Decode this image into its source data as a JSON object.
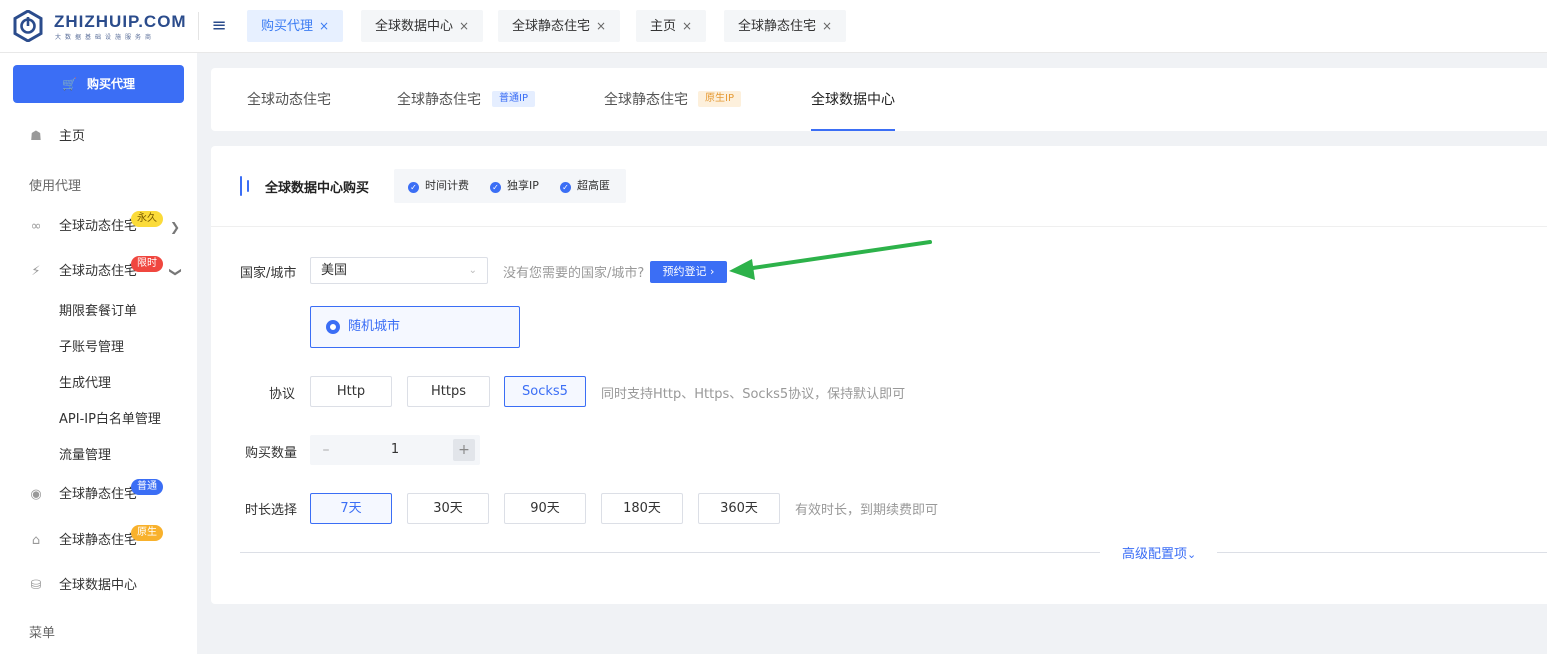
{
  "brand": {
    "name": "ZHIZHUIP.COM",
    "tagline": "大数据基础设施服务商",
    "accent_color": "#3b6ef5"
  },
  "header": {
    "menu_icon": "hamburger-icon",
    "tabs": [
      {
        "label": "购买代理",
        "active": true
      },
      {
        "label": "全球数据中心",
        "active": false
      },
      {
        "label": "全球静态住宅",
        "active": false
      },
      {
        "label": "主页",
        "active": false
      },
      {
        "label": "全球静态住宅",
        "active": false
      }
    ],
    "tab_close": "×"
  },
  "sidebar": {
    "buy_button": "购买代理",
    "home": "主页",
    "section_use": "使用代理",
    "items": [
      {
        "label": "全球动态住宅",
        "badge": "永久"
      },
      {
        "label": "全球动态住宅",
        "badge": "限时"
      },
      {
        "label": "期限套餐订单"
      },
      {
        "label": "子账号管理"
      },
      {
        "label": "生成代理"
      },
      {
        "label": "API-IP白名单管理"
      },
      {
        "label": "流量管理"
      },
      {
        "label": "全球静态住宅",
        "badge": "普通"
      },
      {
        "label": "全球静态住宅",
        "badge": "原生"
      },
      {
        "label": "全球数据中心"
      }
    ],
    "section_menu": "菜单"
  },
  "product_tabs": [
    {
      "label": "全球动态住宅"
    },
    {
      "label": "全球静态住宅",
      "badge": "普通IP"
    },
    {
      "label": "全球静态住宅",
      "badge": "原生IP"
    },
    {
      "label": "全球数据中心",
      "active": true
    }
  ],
  "purchase": {
    "title": "全球数据中心购买",
    "features": [
      "时间计费",
      "独享IP",
      "超高匿"
    ],
    "country_label": "国家/城市",
    "country_value": "美国",
    "country_hint": "没有您需要的国家/城市?",
    "register_button": "预约登记",
    "city_option": "随机城市",
    "protocol_label": "协议",
    "protocols": [
      "Http",
      "Https",
      "Socks5"
    ],
    "protocol_selected": "Socks5",
    "protocol_hint": "同时支持Http、Https、Socks5协议，保持默认即可",
    "quantity_label": "购买数量",
    "quantity_value": "1",
    "duration_label": "时长选择",
    "durations": [
      "7天",
      "30天",
      "90天",
      "180天",
      "360天"
    ],
    "duration_selected": "7天",
    "duration_hint": "有效时长，到期续费即可",
    "advanced_link": "高级配置项"
  },
  "annotation": {
    "color": "#2db24a"
  }
}
